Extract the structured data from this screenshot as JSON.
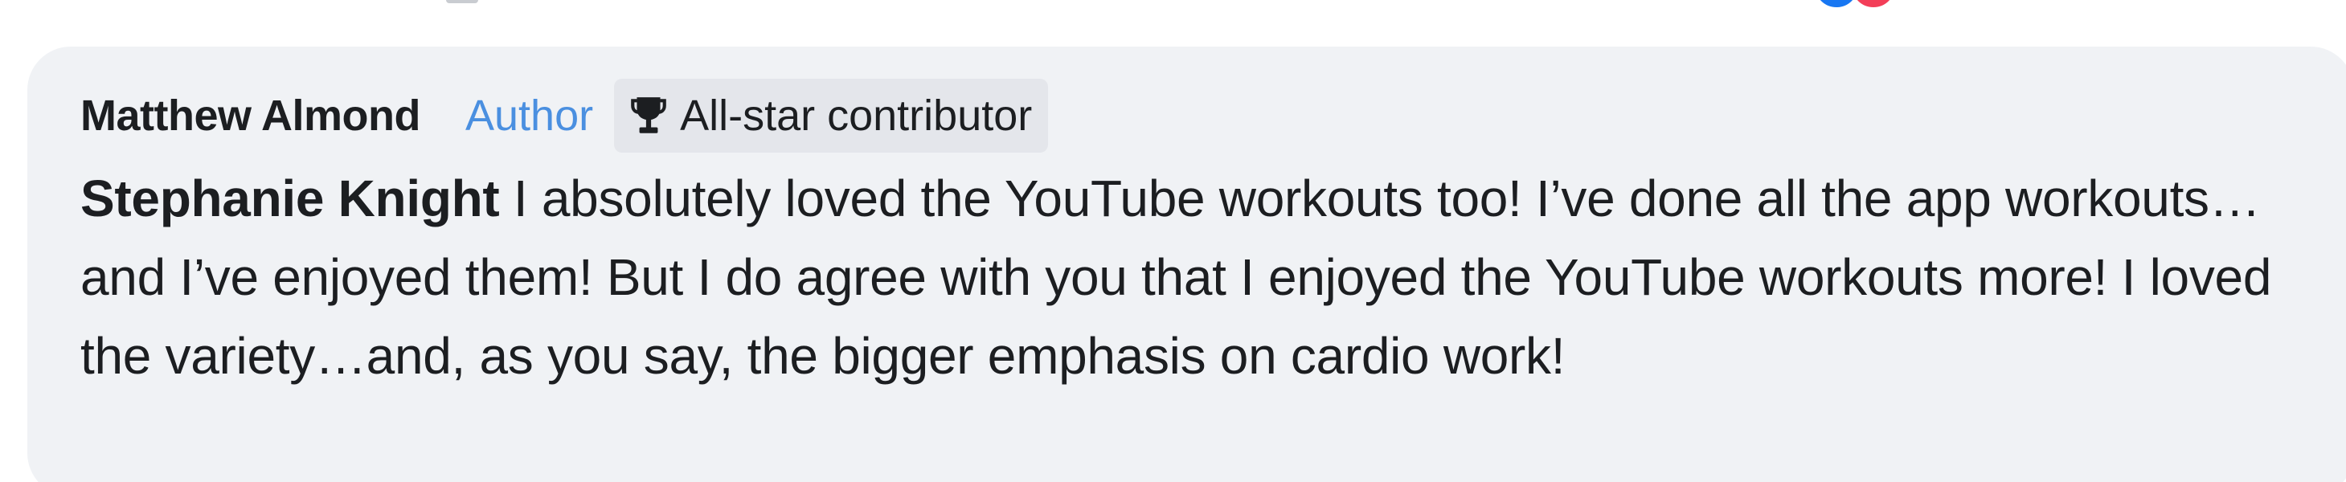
{
  "reactions": [
    "like",
    "love"
  ],
  "comment": {
    "author": "Matthew Almond",
    "author_badge": "Author",
    "contributor_badge": "All-star contributor",
    "contributor_badge_icon": "trophy-icon",
    "mention": "Stephanie Knight",
    "text": " I absolutely loved the YouTube workouts too! I’ve done all the app workouts…and I’ve enjoyed them! But I do agree with you that I enjoyed the YouTube workouts more! I loved the variety…and, as you say, the bigger emphasis on cardio work!"
  },
  "colors": {
    "bubble_background": "#f0f2f5",
    "author_badge": "#4a8fe0",
    "contributor_badge_background": "#e4e6eb",
    "text": "#1c1e21",
    "like_reaction": "#1877f2",
    "love_reaction": "#f33e58"
  }
}
